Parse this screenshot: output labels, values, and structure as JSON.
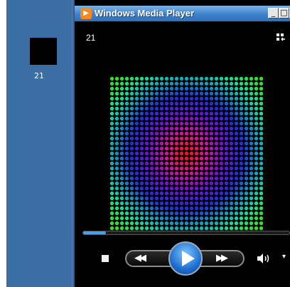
{
  "desktop": {
    "icon_label": "21",
    "background": "#3a6ea5"
  },
  "window": {
    "title": "Windows Media Player",
    "title_icon_glyph": "▶",
    "minimize_glyph": "_",
    "maximize_glyph": "□",
    "close_glyph": "×"
  },
  "player": {
    "now_playing": "21",
    "seek_progress": 0.11,
    "visualization": "radial-gradient-dot-matrix",
    "controls": {
      "prev_glyph": "◀◀",
      "next_glyph": "▶▶",
      "chevron_glyph": "▾"
    }
  },
  "icons": {
    "switch_to_library": "switch-library-icon",
    "volume": "volume-icon"
  }
}
